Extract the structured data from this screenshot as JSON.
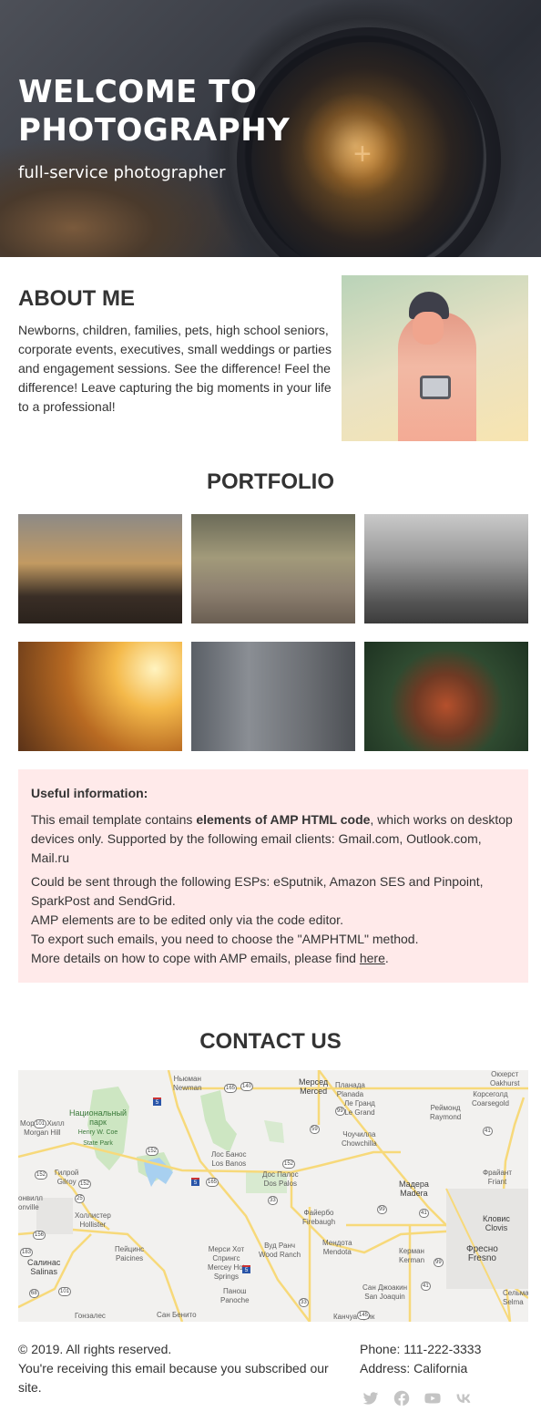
{
  "hero": {
    "title_line1": "WELCOME TO",
    "title_line2": "PHOTOGRAPHY",
    "subtitle": "full-service photographer"
  },
  "about": {
    "title": "ABOUT ME",
    "text": "Newborns, children, families, pets, high school seniors, corporate events, executives, small weddings or parties and engagement sessions. See the difference! Feel the difference! Leave capturing the big moments in your life to a professional!"
  },
  "portfolio": {
    "title": "PORTFOLIO",
    "images": [
      {
        "subject": "city street at sunset"
      },
      {
        "subject": "woman with white tiger"
      },
      {
        "subject": "black and white silhouette with flowers"
      },
      {
        "subject": "girl in golden field"
      },
      {
        "subject": "woman covering face with sweater"
      },
      {
        "subject": "redhead among white flowers"
      }
    ]
  },
  "info": {
    "heading": "Useful information:",
    "p1_before": "This email template contains ",
    "p1_bold": "elements of AMP HTML code",
    "p1_after": ", which works on desktop devices only. Supported by the following email clients: Gmail.com, Outlook.com, Mail.ru",
    "p2_line1": "Could be sent through the following ESPs: eSputnik, Amazon SES and Pinpoint, SparkPost and SendGrid.",
    "p2_line2": "AMP elements are to be edited only via the code editor.",
    "p2_line3": "To export such emails, you need to choose the \"AMPHTML\" method.",
    "p2_line4_before": "More details on how to cope with AMP emails, please find ",
    "p2_link": "here",
    "p2_line4_after": "."
  },
  "contact": {
    "title": "CONTACT US",
    "map_labels": {
      "newman": [
        "Ньюман",
        "Newman"
      ],
      "merced": [
        "Мерсед",
        "Merced"
      ],
      "planada": [
        "Планада",
        "Planada"
      ],
      "legrand": [
        "Ле Гранд",
        "Le Grand"
      ],
      "oakhurst": [
        "Окхерст",
        "Oakhurst"
      ],
      "coarsegold": [
        "Корсеголд",
        "Coarsegold"
      ],
      "raymond": [
        "Реймонд",
        "Raymond"
      ],
      "park": [
        "Национальный",
        "парк",
        "Henry W. Coe",
        "State Park"
      ],
      "morganhill": [
        "Морган Хилл",
        "Morgan Hill"
      ],
      "chowchilla": [
        "Чоучилла",
        "Chowchilla"
      ],
      "losbanos": [
        "Лос Банос",
        "Los Banos"
      ],
      "gilroy": [
        "Гилрой",
        "Gilroy"
      ],
      "dospalos": [
        "Дос Палос",
        "Dos Palos"
      ],
      "madera": [
        "Мадера",
        "Madera"
      ],
      "friant": [
        "Фрайант",
        "Friant"
      ],
      "watsonville": [
        "онвилл",
        "onville"
      ],
      "hollister": [
        "Холлистер",
        "Hollister"
      ],
      "firebaugh": [
        "Файербо",
        "Firebaugh"
      ],
      "clovis": [
        "Кловис",
        "Clovis"
      ],
      "paicines": [
        "Пейцинс",
        "Paicines"
      ],
      "merceyhot": [
        "Мерси Хот",
        "Спрингс",
        "Mercey Hot",
        "Springs"
      ],
      "woodranch": [
        "Вуд Ранч",
        "Wood Ranch"
      ],
      "mendota": [
        "Мендота",
        "Mendota"
      ],
      "kerman": [
        "Керман",
        "Kerman"
      ],
      "fresno": [
        "Фресно",
        "Fresno"
      ],
      "salinas": [
        "Салинас",
        "Salinas"
      ],
      "panoche": [
        "Панош",
        "Panoche"
      ],
      "sanjoaquin": [
        "Сан Джоакин",
        "San Joaquin"
      ],
      "selma": [
        "Сельма",
        "Selma"
      ],
      "gonzales": [
        "Гонзалес"
      ],
      "sanbenito": [
        "Сан Бенито"
      ],
      "cantuacreek": [
        "Канчуа Крик"
      ]
    },
    "route_shields": [
      "165",
      "140",
      "99",
      "59",
      "41",
      "101",
      "152",
      "152",
      "165",
      "152",
      "152",
      "25",
      "33",
      "99",
      "41",
      "156",
      "183",
      "99",
      "101",
      "68",
      "33",
      "41",
      "145",
      "5",
      "5",
      "5"
    ]
  },
  "footer": {
    "copyright": "© 2019. All rights reserved.",
    "subscribed": "You're receiving this email because you subscribed our site.",
    "phone": "Phone: 111-222-3333",
    "address": "Address: California",
    "social": [
      "twitter",
      "facebook",
      "youtube",
      "vk"
    ]
  }
}
